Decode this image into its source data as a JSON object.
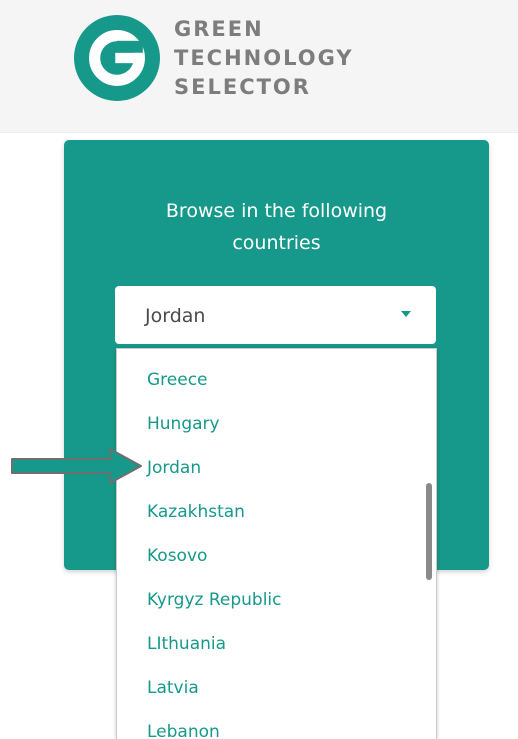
{
  "header": {
    "logo_lines": [
      "GREEN",
      "TECHNOLOGY",
      "SELECTOR"
    ],
    "logo_icon": "g-logo-icon",
    "brand_color": "#16998a"
  },
  "browse": {
    "title_line1": "Browse in the following",
    "title_line2": "countries",
    "selected": "Jordan",
    "options": [
      "Greece",
      "Hungary",
      "Jordan",
      "Kazakhstan",
      "Kosovo",
      "Kyrgyz Republic",
      "LIthuania",
      "Latvia",
      "Lebanon"
    ],
    "highlighted_index": 2
  },
  "annotation": {
    "icon": "pointer-arrow-icon",
    "color": "#16998a"
  }
}
